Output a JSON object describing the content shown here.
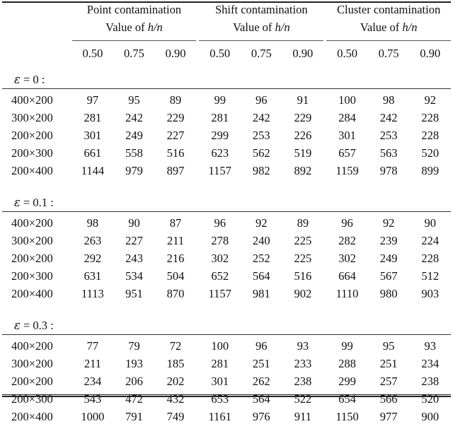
{
  "table": {
    "column_groups": [
      {
        "title": "Point contamination",
        "subtitle_prefix": "Value of ",
        "subtitle_math": "h/n"
      },
      {
        "title": "Shift contamination",
        "subtitle_prefix": "Value of ",
        "subtitle_math": "h/n"
      },
      {
        "title": "Cluster contamination",
        "subtitle_prefix": "Value of ",
        "subtitle_math": "h/n"
      }
    ],
    "sub_headers": [
      "0.50",
      "0.75",
      "0.90"
    ],
    "row_label_header": "",
    "sections": [
      {
        "label_symbol": "ε",
        "label_text": " = 0 :",
        "full_label": "ε = 0 :",
        "rows": [
          {
            "label": "400×200",
            "values": [
              "97",
              "95",
              "89",
              "99",
              "96",
              "91",
              "100",
              "98",
              "92"
            ]
          },
          {
            "label": "300×200",
            "values": [
              "281",
              "242",
              "229",
              "281",
              "242",
              "229",
              "284",
              "242",
              "228"
            ]
          },
          {
            "label": "200×200",
            "values": [
              "301",
              "249",
              "227",
              "299",
              "253",
              "226",
              "301",
              "253",
              "228"
            ]
          },
          {
            "label": "200×300",
            "values": [
              "661",
              "558",
              "516",
              "623",
              "562",
              "519",
              "657",
              "563",
              "520"
            ]
          },
          {
            "label": "200×400",
            "values": [
              "1144",
              "979",
              "897",
              "1157",
              "982",
              "892",
              "1159",
              "978",
              "899"
            ]
          }
        ]
      },
      {
        "label_symbol": "ε",
        "label_text": " = 0.1 :",
        "full_label": "ε = 0.1 :",
        "rows": [
          {
            "label": "400×200",
            "values": [
              "98",
              "90",
              "87",
              "96",
              "92",
              "89",
              "96",
              "92",
              "90"
            ]
          },
          {
            "label": "300×200",
            "values": [
              "263",
              "227",
              "211",
              "278",
              "240",
              "225",
              "282",
              "239",
              "224"
            ]
          },
          {
            "label": "200×200",
            "values": [
              "292",
              "243",
              "216",
              "302",
              "252",
              "225",
              "302",
              "249",
              "228"
            ]
          },
          {
            "label": "200×300",
            "values": [
              "631",
              "534",
              "504",
              "652",
              "564",
              "516",
              "664",
              "567",
              "512"
            ]
          },
          {
            "label": "200×400",
            "values": [
              "1113",
              "951",
              "870",
              "1157",
              "981",
              "902",
              "1110",
              "980",
              "903"
            ]
          }
        ]
      },
      {
        "label_symbol": "ε",
        "label_text": " = 0.3 :",
        "full_label": "ε = 0.3 :",
        "rows": [
          {
            "label": "400×200",
            "values": [
              "77",
              "79",
              "72",
              "100",
              "96",
              "93",
              "99",
              "95",
              "93"
            ]
          },
          {
            "label": "300×200",
            "values": [
              "211",
              "193",
              "185",
              "281",
              "251",
              "233",
              "288",
              "251",
              "234"
            ]
          },
          {
            "label": "200×200",
            "values": [
              "234",
              "206",
              "202",
              "301",
              "262",
              "238",
              "299",
              "257",
              "238"
            ]
          },
          {
            "label": "200×300",
            "values": [
              "543",
              "472",
              "432",
              "653",
              "564",
              "522",
              "654",
              "566",
              "520"
            ]
          },
          {
            "label": "200×400",
            "values": [
              "1000",
              "791",
              "749",
              "1161",
              "976",
              "911",
              "1150",
              "977",
              "900"
            ]
          }
        ]
      }
    ],
    "rule_color": "#222222",
    "text_color": "#111111"
  }
}
